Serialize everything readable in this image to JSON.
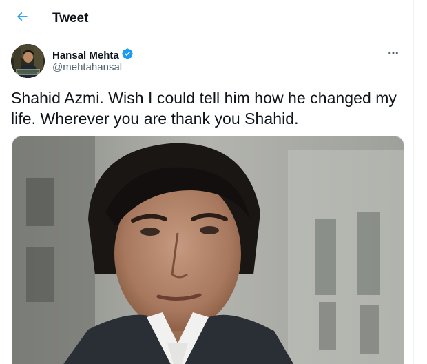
{
  "header": {
    "title": "Tweet",
    "back_icon": "arrow-left-icon",
    "accent_color": "#1d9bf0"
  },
  "tweet": {
    "author": {
      "display_name": "Hansal Mehta",
      "handle": "@mehtahansal",
      "verified": true,
      "verified_icon": "verified-badge-icon",
      "avatar_icon": "avatar"
    },
    "more_icon": "more-horizontal-icon",
    "text": "Shahid Azmi. Wish I could tell him how he changed my life. Wherever you are thank you Shahid.",
    "media": {
      "type": "photo",
      "description_icon": "photo"
    }
  }
}
